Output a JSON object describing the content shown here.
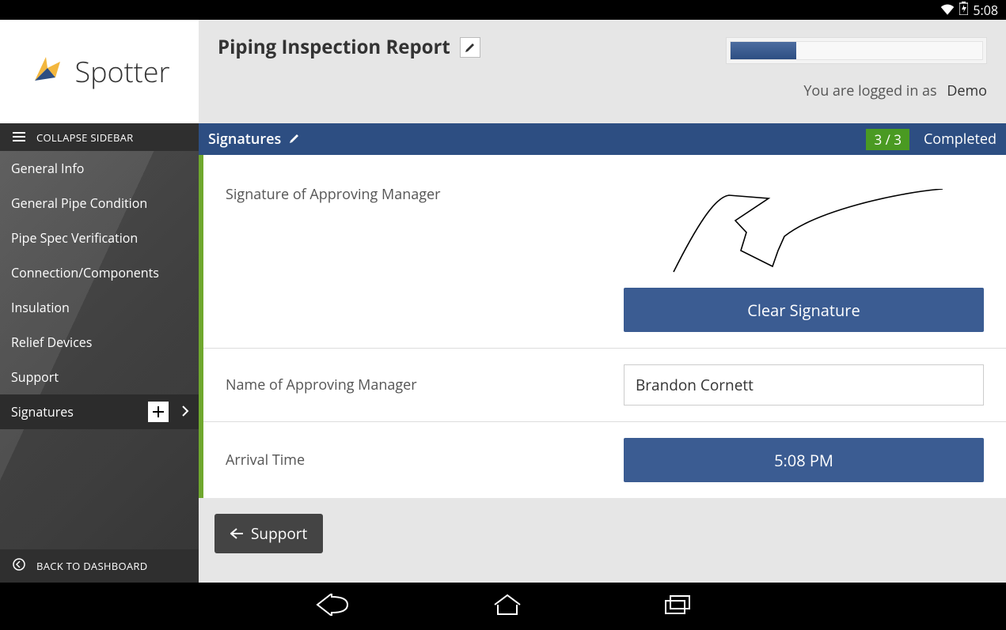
{
  "statusbar": {
    "time": "5:08"
  },
  "brand": {
    "name": "Spotter"
  },
  "sidebar": {
    "collapse_label": "COLLAPSE SIDEBAR",
    "back_label": "BACK TO DASHBOARD",
    "items": [
      {
        "label": "General Info"
      },
      {
        "label": "General Pipe Condition"
      },
      {
        "label": "Pipe Spec Verification"
      },
      {
        "label": "Connection/Components"
      },
      {
        "label": "Insulation"
      },
      {
        "label": "Relief Devices"
      },
      {
        "label": "Support"
      },
      {
        "label": "Signatures",
        "active": true
      }
    ]
  },
  "header": {
    "title": "Piping Inspection Report",
    "login_prefix": "You are logged in as",
    "login_user": "Demo"
  },
  "section": {
    "title": "Signatures",
    "count": "3 / 3",
    "status": "Completed"
  },
  "fields": {
    "signature_label": "Signature of Approving Manager",
    "clear_button": "Clear Signature",
    "manager_label": "Name of Approving Manager",
    "manager_value": "Brandon Cornett",
    "arrival_label": "Arrival Time",
    "arrival_value": "5:08 PM"
  },
  "footer": {
    "back_button": "Support"
  }
}
